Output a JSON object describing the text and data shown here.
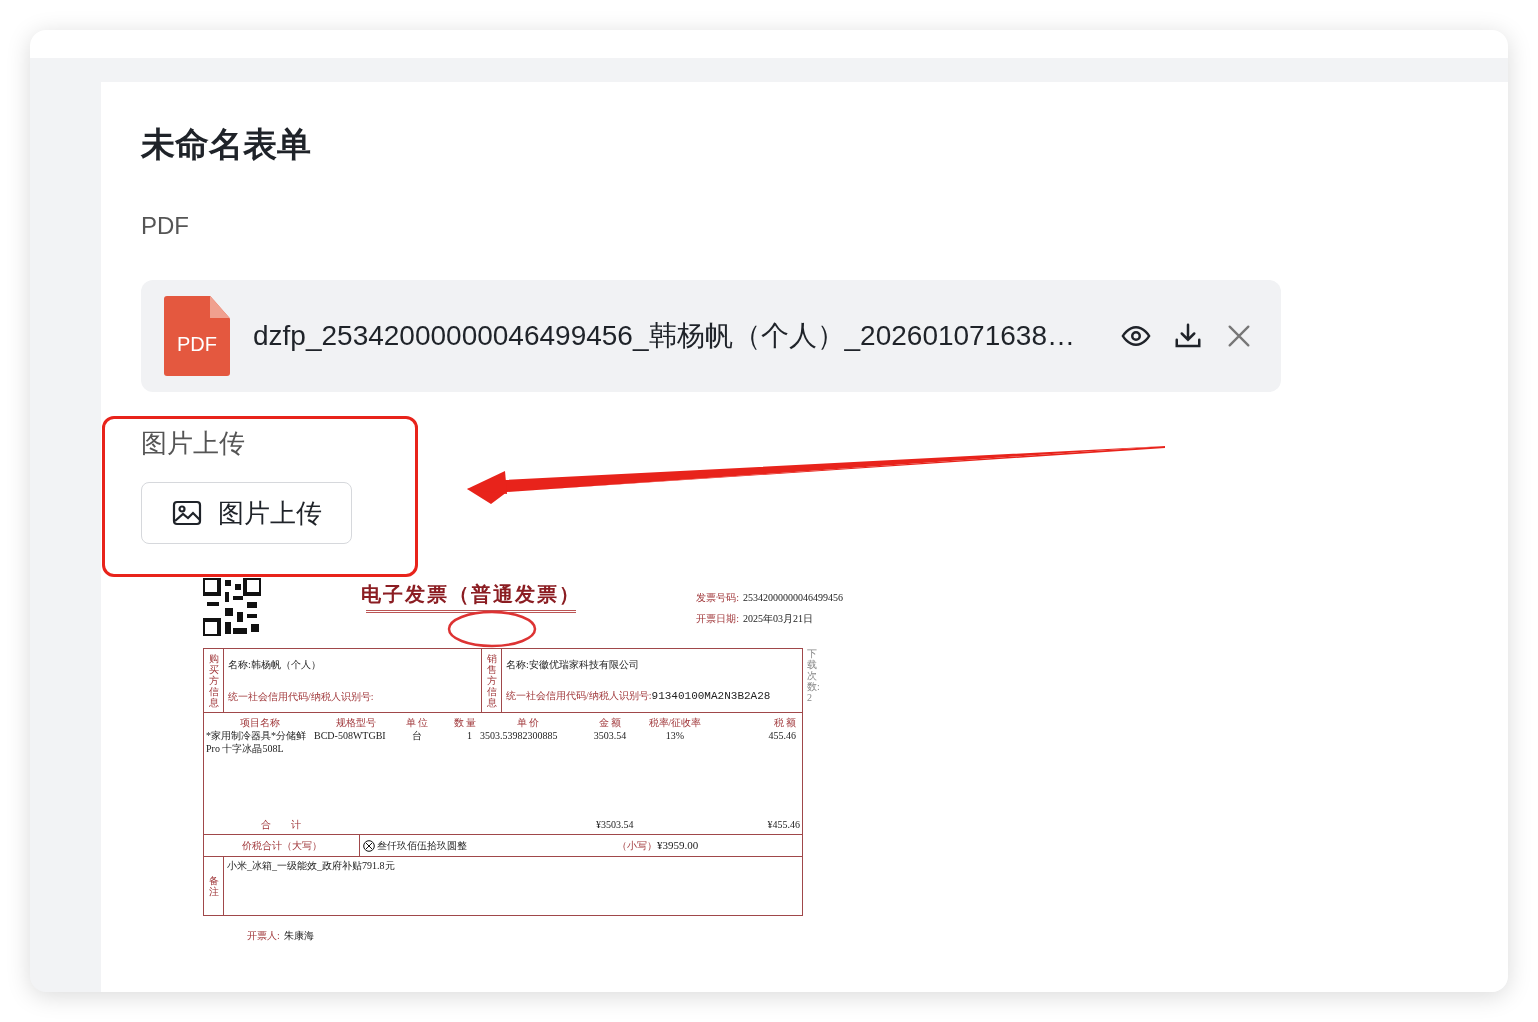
{
  "form": {
    "title": "未命名表单"
  },
  "pdf_field": {
    "label": "PDF",
    "file": {
      "badge": "PDF",
      "name": "dzfp_25342000000046499456_韩杨帆（个人）_202601071638…"
    }
  },
  "image_field": {
    "label": "图片上传",
    "button": "图片上传"
  },
  "invoice": {
    "title": "电子发票（普通发票）",
    "number_label": "发票号码:",
    "number": "25342000000046499456",
    "date_label": "开票日期:",
    "date": "2025年03月21日",
    "buyer_side": "购买方信息",
    "buyer_name": "名称:韩杨帆（个人）",
    "buyer_id": "统一社会信用代码/纳税人识别号:",
    "seller_side": "销售方信息",
    "seller_name": "名称:安徽优瑞家科技有限公司",
    "seller_id_label": "统一社会信用代码/纳税人识别号:",
    "seller_id": "91340100MA2N3B2A28",
    "columns": [
      "项目名称",
      "规格型号",
      "单 位",
      "数 量",
      "单 价",
      "金 额",
      "税率/征收率",
      "税 额"
    ],
    "item": [
      "*家用制冷器具*分储鲜Pro 十字冰晶508L",
      "BCD-508WTGBI",
      "台",
      "1",
      "3503.53982300885",
      "3503.54",
      "13%",
      "455.46"
    ],
    "total_label": "合　　计",
    "total_amount": "¥3503.54",
    "total_tax": "¥455.46",
    "sum_label": "价税合计（大写）",
    "sum_words": "叁仟玖佰伍拾玖圆整",
    "sum_small_label": "（小写）",
    "sum_small": "¥3959.00",
    "remarks_label": "备注",
    "remarks": "小米_冰箱_一级能效_政府补贴791.8元",
    "side_note": "下载次数: 2",
    "issuer_label": "开票人:",
    "issuer": "朱康海"
  }
}
